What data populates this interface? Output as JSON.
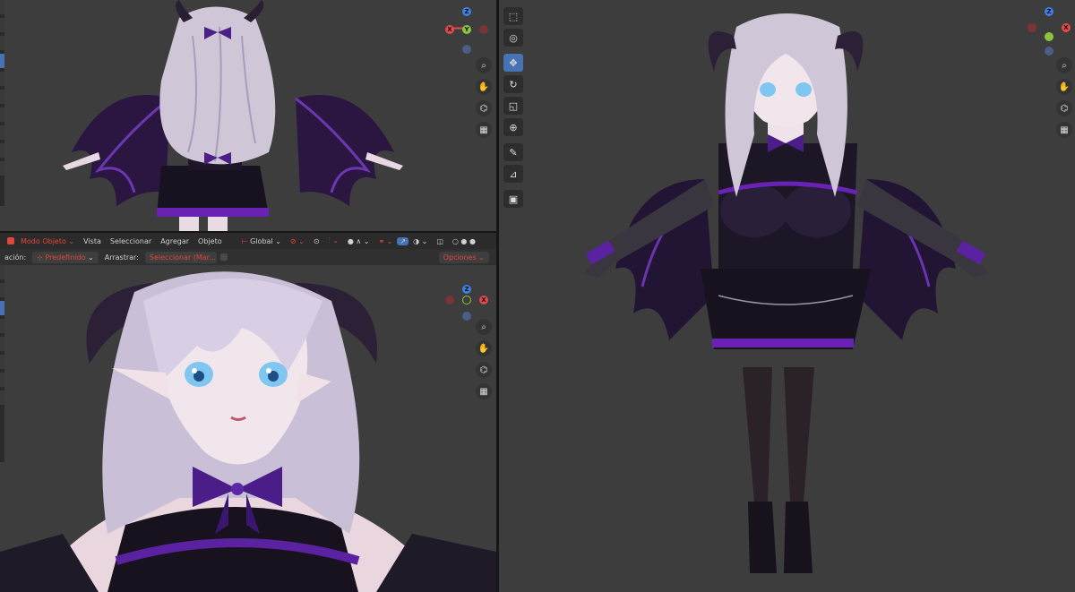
{
  "header": {
    "mode": "Modo Objeto",
    "menus": [
      "Vista",
      "Seleccionar",
      "Agregar",
      "Objeto"
    ],
    "orientation": "Global",
    "accent": "#4772b3"
  },
  "tool_settings": {
    "orientation_label": "ación:",
    "pivot": "Predefinido",
    "drag_label": "Arrastrar:",
    "drag_value": "Seleccionar (Mar...",
    "options": "Opciones"
  },
  "gizmo": {
    "x": "X",
    "y": "Y",
    "z": "Z"
  },
  "icons": [
    "zoom-icon",
    "hand-pan-icon",
    "camera-icon",
    "grid-icon",
    "select-box-icon",
    "cursor-icon",
    "move-icon",
    "rotate-icon",
    "scale-icon",
    "transform-icon",
    "annotate-icon",
    "measure-icon",
    "add-cube-icon"
  ]
}
